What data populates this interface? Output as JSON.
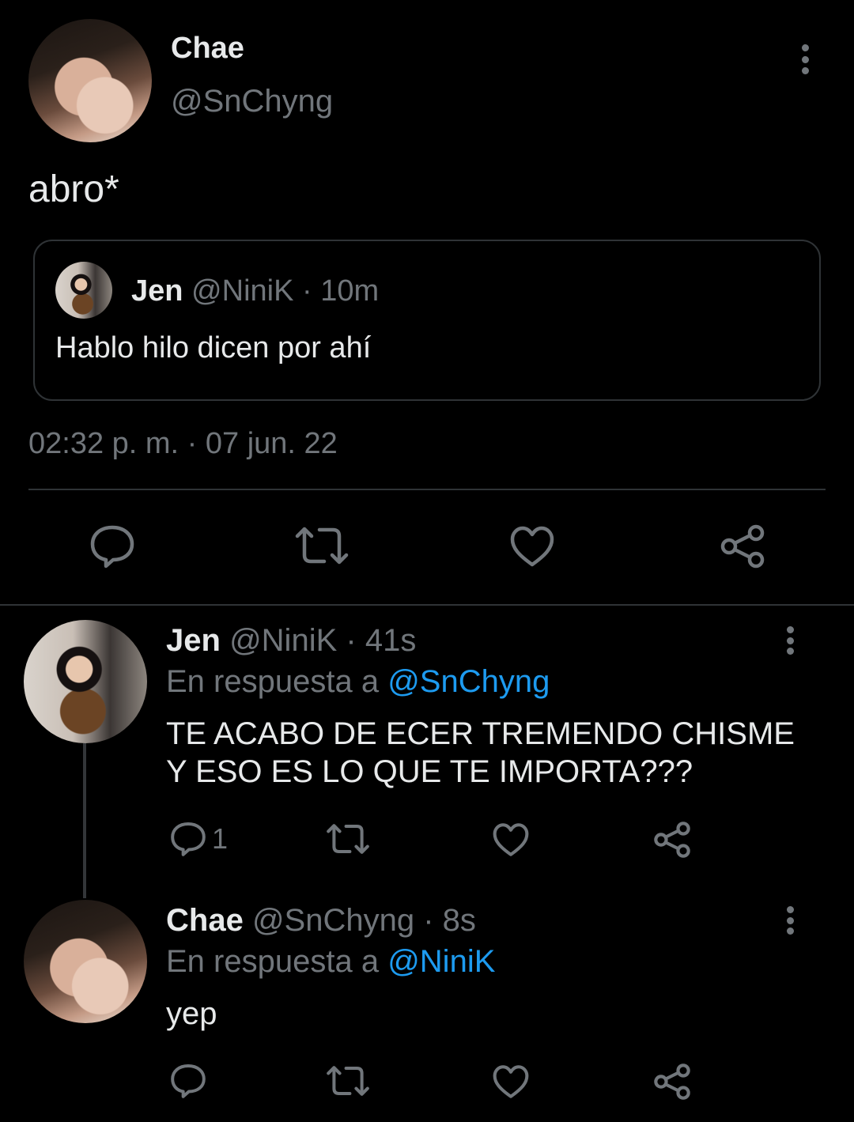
{
  "main_tweet": {
    "author_name": "Chae",
    "author_handle": "@SnChyng",
    "text": "abro*",
    "timestamp": "02:32 p. m. · 07 jun. 22",
    "quote": {
      "author_name": "Jen",
      "author_handle": "@NiniK",
      "age": "· 10m",
      "text": "Hablo hilo dicen por ahí"
    }
  },
  "replies": [
    {
      "author_name": "Jen",
      "author_handle": "@NiniK",
      "age": "· 41s",
      "reply_prefix": "En respuesta a",
      "reply_to": "@SnChyng",
      "text_line1": "TE ACABO DE ECER TREMENDO CHISME",
      "text_line2": "Y ESO ES LO QUE TE IMPORTA???",
      "reply_count": "1"
    },
    {
      "author_name": "Chae",
      "author_handle": "@SnChyng",
      "age": "· 8s",
      "reply_prefix": "En respuesta a",
      "reply_to": "@NiniK",
      "text": "yep"
    }
  ],
  "icons": [
    "more-icon",
    "reply-icon",
    "retweet-icon",
    "like-icon",
    "share-icon"
  ],
  "colors": {
    "background": "#000000",
    "text": "#e7e9ea",
    "muted": "#71767b",
    "link": "#1d9bf0",
    "border": "#2f3336"
  }
}
